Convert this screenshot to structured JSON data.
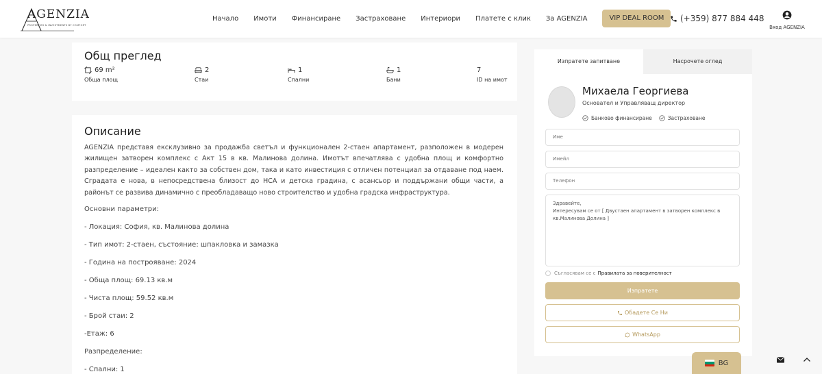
{
  "header": {
    "logo_text": "AGENZIA",
    "logo_sub": "PROPERTIES & INVESTMENTS BY COMFORT",
    "nav": [
      "Начало",
      "Имоти",
      "Финансиране",
      "Застраховане",
      "Интериори",
      "Платете с клик",
      "За AGENZIA"
    ],
    "vip_label": "VIP DEAL ROOM",
    "phone": "(+359) 877 884 448",
    "login_label": "Вход AGENZIA"
  },
  "overview": {
    "title": "Общ преглед",
    "stats": [
      {
        "icon": "area-icon",
        "value": "69 m²",
        "label": "Обща площ"
      },
      {
        "icon": "sofa-icon",
        "value": "2",
        "label": "Стаи"
      },
      {
        "icon": "bed-icon",
        "value": "1",
        "label": "Спални"
      },
      {
        "icon": "bath-icon",
        "value": "1",
        "label": "Бани"
      },
      {
        "icon": "",
        "value": "7",
        "label": "ID на имот"
      }
    ]
  },
  "description": {
    "title": "Описание",
    "body": "AGENZIA представя ексклузивно за продажба светъл и функционален 2-стаен апартамент, разположен в модерен жилищен затворен комплекс с Акт 15 в кв. Малинова долина. Имотът впечатлява с удобна площ и комфортно разпределение – идеален както за собствен дом, така и като инвестиция с отличен потенциал за отдаване под наем. Сградата е нова, в непосредствена близост до НСА и детска градина, с асансьор и поддържани общи части, а районът се развива динамично с преобладаващо ново строителство и удобна градска инфраструктура.",
    "lines": [
      "Основни параметри:",
      "- Локация: София, кв. Малинова долина",
      "- Тип имот: 2-стаен, състояние: шпакловка и замазка",
      "- Година на построяване: 2024",
      "- Обща площ: 69.13 кв.м",
      "- Чиста площ: 59.52 кв.м",
      "- Брой стаи: 2",
      "-Етаж: 6",
      "Разпределение:",
      "- Спални: 1"
    ]
  },
  "sidebar": {
    "tabs": [
      "Изпратете запитване",
      "Насрочете оглед"
    ],
    "agent": {
      "name": "Михаела Георгиева",
      "role": "Основател и Управляващ директор",
      "tags": [
        "Банково финансиране",
        "Застраховане"
      ]
    },
    "form": {
      "name_placeholder": "Име",
      "email_placeholder": "Имейл",
      "phone_placeholder": "Телефон",
      "message_line1": "Здравейте,",
      "message_line2": "Интересувам се от [ Двустаен апартамент в затворен комплекс в кв.Малинова Долина ]",
      "consent_text": "Съгласявам се с",
      "consent_link": "Правилата за поверителност",
      "send_label": "Изпратете",
      "call_label": "Обадете Се Ни",
      "whatsapp_label": "WhatsApp"
    }
  },
  "widgets": {
    "lang_label": "BG",
    "flag_colors": [
      "#ffffff",
      "#00966e",
      "#d62612"
    ]
  },
  "colors": {
    "accent": "#d6c191",
    "accent_dark": "#b59a5d"
  }
}
